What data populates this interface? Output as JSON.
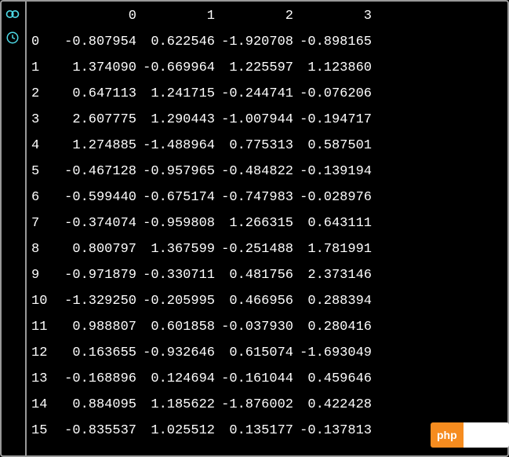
{
  "chart_data": {
    "type": "table",
    "columns": [
      "0",
      "1",
      "2",
      "3"
    ],
    "index": [
      "0",
      "1",
      "2",
      "3",
      "4",
      "5",
      "6",
      "7",
      "8",
      "9",
      "10",
      "11",
      "12",
      "13",
      "14",
      "15"
    ],
    "rows": [
      [
        -0.807954,
        0.622546,
        -1.920708,
        -0.898165
      ],
      [
        1.37409,
        -0.669964,
        1.225597,
        1.12386
      ],
      [
        0.647113,
        1.241715,
        -0.244741,
        -0.076206
      ],
      [
        2.607775,
        1.290443,
        -1.007944,
        -0.194717
      ],
      [
        1.274885,
        -1.488964,
        0.775313,
        0.587501
      ],
      [
        -0.467128,
        -0.957965,
        -0.484822,
        -0.139194
      ],
      [
        -0.59944,
        -0.675174,
        -0.747983,
        -0.028976
      ],
      [
        -0.374074,
        -0.959808,
        1.266315,
        0.643111
      ],
      [
        0.800797,
        1.367599,
        -0.251488,
        1.781991
      ],
      [
        -0.971879,
        -0.330711,
        0.481756,
        2.373146
      ],
      [
        -1.32925,
        -0.205995,
        0.466956,
        0.288394
      ],
      [
        0.988807,
        0.601858,
        -0.03793,
        0.280416
      ],
      [
        0.163655,
        -0.932646,
        0.615074,
        -1.693049
      ],
      [
        -0.168896,
        0.124694,
        -0.161044,
        0.459646
      ],
      [
        0.884095,
        1.185622,
        -1.876002,
        0.422428
      ],
      [
        -0.835537,
        1.025512,
        0.135177,
        -0.137813
      ]
    ]
  },
  "watermark": {
    "label": "php"
  }
}
